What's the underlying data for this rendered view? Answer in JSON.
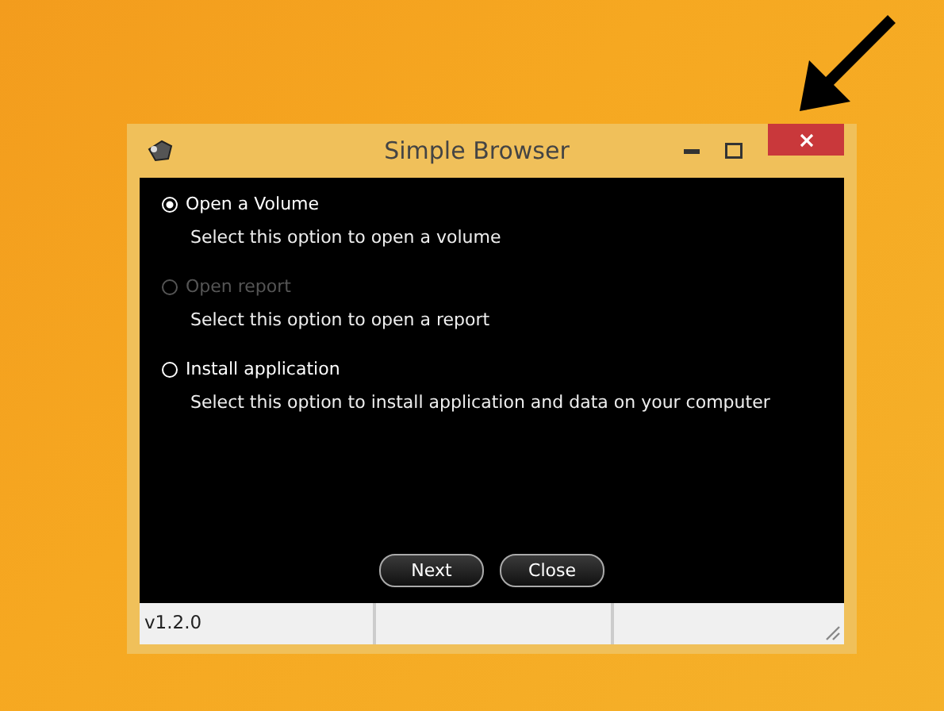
{
  "window": {
    "title": "Simple Browser"
  },
  "options": [
    {
      "label": "Open a Volume",
      "description": "Select this option to open a volume",
      "selected": true,
      "disabled": false
    },
    {
      "label": "Open report",
      "description": "Select this option to open a report",
      "selected": false,
      "disabled": true
    },
    {
      "label": "Install application",
      "description": "Select this option to install application and data on your computer",
      "selected": false,
      "disabled": false
    }
  ],
  "buttons": [
    "Next",
    "Close"
  ],
  "status_bar": {
    "version": "v1.2.0"
  }
}
